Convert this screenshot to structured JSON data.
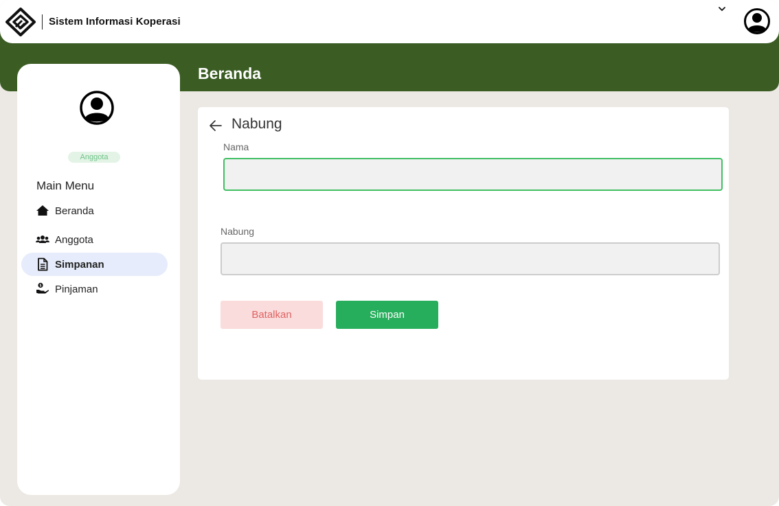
{
  "header": {
    "app_title": "Sistem Informasi Koperasi",
    "logo_icon": "koperasi-logo",
    "dropdown_icon": "chevron-down-icon",
    "avatar_icon": "user-avatar-icon"
  },
  "page": {
    "heading": "Beranda"
  },
  "sidebar": {
    "role_badge": "Anggota",
    "menu_title": "Main Menu",
    "items": [
      {
        "label": "Beranda",
        "icon": "home-icon",
        "active": false
      },
      {
        "label": "Anggota",
        "icon": "users-icon",
        "active": false
      },
      {
        "label": "Simpanan",
        "icon": "document-icon",
        "active": true
      },
      {
        "label": "Pinjaman",
        "icon": "hand-money-icon",
        "active": false
      }
    ]
  },
  "form": {
    "title": "Nabung",
    "fields": [
      {
        "label": "Nama",
        "value": "",
        "placeholder": ""
      },
      {
        "label": "Nabung",
        "value": "",
        "placeholder": ""
      }
    ],
    "cancel_label": "Batalkan",
    "save_label": "Simpan"
  },
  "colors": {
    "brand_green": "#3b5d24",
    "accent_green": "#27ae5c",
    "cancel_bg": "#fadcdc",
    "cancel_text": "#e06262",
    "active_menu_bg": "#e6ecfb",
    "page_bg": "#ece8e3"
  }
}
